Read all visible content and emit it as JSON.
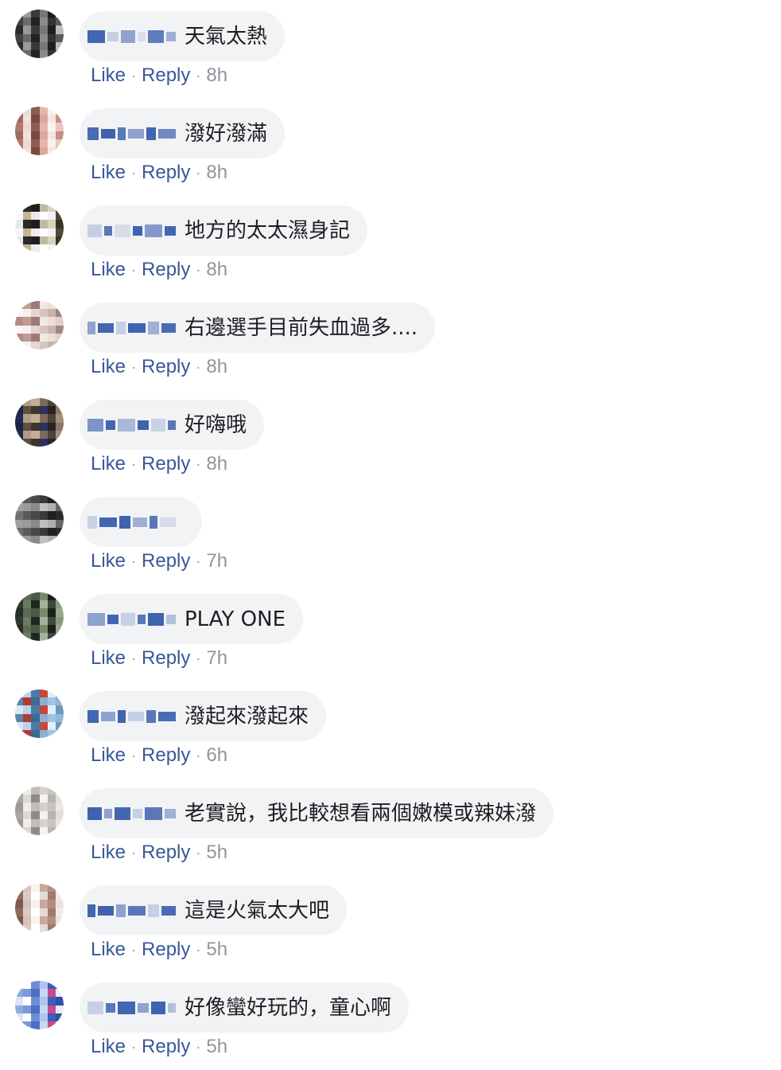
{
  "comments": [
    {
      "text": "天氣太熱",
      "like_label": "Like",
      "reply_label": "Reply",
      "time": "8h",
      "avatar_colors": [
        "#2b2b2b",
        "#6a6a6a",
        "#3a3a3a",
        "#8b8b8b",
        "#1e1e1e",
        "#5a5a5a",
        "#444444",
        "#999999",
        "#222222",
        "#777777",
        "#333333",
        "#bbbbbb"
      ],
      "name_blocks": [
        "#4267b2",
        "#c7cfe3",
        "#8fa3cc",
        "#d9deea",
        "#5f7dbb",
        "#9fb0d4"
      ]
    },
    {
      "text": "潑好潑滿",
      "like_label": "Like",
      "reply_label": "Reply",
      "time": "8h",
      "avatar_colors": [
        "#e9c6c0",
        "#b07a6d",
        "#f3e0da",
        "#8f5b52",
        "#d9a89c",
        "#fbf0ec",
        "#c68f83",
        "#a06a5e",
        "#eddad4",
        "#7a4a40",
        "#e2b7ad",
        "#f6e6e1"
      ],
      "name_blocks": [
        "#4a6cb4",
        "#3f63ae",
        "#5a79ba",
        "#8ea2cf",
        "#4267b2",
        "#6f89c2"
      ]
    },
    {
      "text": "地方的太太濕身記",
      "like_label": "Like",
      "reply_label": "Reply",
      "time": "8h",
      "avatar_colors": [
        "#f2f2f2",
        "#3a3326",
        "#e8e8e8",
        "#c4b58d",
        "#1e1e1e",
        "#ffffff",
        "#d8d1bd",
        "#4e4838",
        "#f7f7f7",
        "#2a2a2a",
        "#ececec",
        "#bfb9a6"
      ],
      "name_blocks": [
        "#c5cfe4",
        "#5a77b8",
        "#d6dcea",
        "#3f63ae",
        "#8499c9",
        "#4267b2"
      ]
    },
    {
      "text": "右邊選手目前失血過多....",
      "like_label": "Like",
      "reply_label": "Reply",
      "time": "8h",
      "avatar_colors": [
        "#f1e8e6",
        "#c9b3ae",
        "#e2cfcb",
        "#b58b84",
        "#f7f0ee",
        "#9c7b75",
        "#d8c4bf",
        "#ebddd9",
        "#a48680",
        "#fbf5f4",
        "#c09d97",
        "#e6d6d2"
      ],
      "name_blocks": [
        "#8ea2cf",
        "#4267b2",
        "#c6d0e5",
        "#3f63ae",
        "#9fb0d4",
        "#4a6cb4"
      ]
    },
    {
      "text": "好嗨哦",
      "like_label": "Like",
      "reply_label": "Reply",
      "time": "8h",
      "avatar_colors": [
        "#3e342c",
        "#7c6a5a",
        "#2a2420",
        "#a38f7a",
        "#1f2a52",
        "#5c4f43",
        "#c3ae96",
        "#283262",
        "#4d4236",
        "#8a7866",
        "#1c2448",
        "#b09c86"
      ],
      "name_blocks": [
        "#7d93c6",
        "#4267b2",
        "#a9b8da",
        "#3f63ae",
        "#c9d1e5",
        "#5a77b8"
      ]
    },
    {
      "text": "",
      "like_label": "Like",
      "reply_label": "Reply",
      "time": "7h",
      "avatar_colors": [
        "#5a5a5a",
        "#8a8a8a",
        "#3a3a3a",
        "#b0b0b0",
        "#2a2a2a",
        "#707070",
        "#9a9a9a",
        "#4a4a4a",
        "#c0c0c0",
        "#202020",
        "#666666",
        "#a0a0a0"
      ],
      "name_blocks": [
        "#c8d0e4",
        "#4267b2",
        "#3f63ae",
        "#9fb0d4",
        "#5a77b8",
        "#d5dbe9"
      ]
    },
    {
      "text": "PLAY ONE",
      "like_label": "Like",
      "reply_label": "Reply",
      "time": "7h",
      "avatar_colors": [
        "#2f3a2c",
        "#5d6b55",
        "#1f2620",
        "#7a8870",
        "#3e4a38",
        "#98a68e",
        "#26302a",
        "#6b7a62",
        "#4a5a42",
        "#a4b19c",
        "#1a201a",
        "#8a9880"
      ],
      "name_blocks": [
        "#8ea2cf",
        "#4267b2",
        "#c6d0e5",
        "#5a77b8",
        "#3f63ae",
        "#b3c0dd"
      ]
    },
    {
      "text": "潑起來潑起來",
      "like_label": "Like",
      "reply_label": "Reply",
      "time": "6h",
      "avatar_colors": [
        "#8fb8d8",
        "#5a86ad",
        "#b9d4ea",
        "#3e6a92",
        "#c7463f",
        "#a1c3e0",
        "#6f97bd",
        "#d9e8f4",
        "#b33a34",
        "#4d7aa2",
        "#8eb0cf",
        "#e3eef7"
      ],
      "name_blocks": [
        "#4267b2",
        "#8ea2cf",
        "#3f63ae",
        "#c6d0e5",
        "#5a77b8",
        "#4a6cb4"
      ]
    },
    {
      "text": "老實說，我比較想看兩個嫩模或辣妹潑",
      "like_label": "Like",
      "reply_label": "Reply",
      "time": "5h",
      "avatar_colors": [
        "#c7c4bf",
        "#e2dfda",
        "#a9a59f",
        "#f0ede9",
        "#8e8a84",
        "#d4d1cc",
        "#b8b4ae",
        "#eae7e3",
        "#9d9993",
        "#dcd9d4",
        "#c0bcb6",
        "#f5f3f0"
      ],
      "name_blocks": [
        "#3f63ae",
        "#8ea2cf",
        "#4267b2",
        "#c6d0e5",
        "#5a77b8",
        "#9fb0d4"
      ]
    },
    {
      "text": "這是火氣太大吧",
      "like_label": "Like",
      "reply_label": "Reply",
      "time": "5h",
      "avatar_colors": [
        "#e6dcd6",
        "#b58e80",
        "#f2ebe7",
        "#8f6a5e",
        "#d6c3ba",
        "#ffffff",
        "#c7a89c",
        "#a07a6d",
        "#ede2dd",
        "#7c5a50",
        "#dccbc3",
        "#f8f3f0"
      ],
      "name_blocks": [
        "#4267b2",
        "#3f63ae",
        "#8ea2cf",
        "#5a77b8",
        "#c6d0e5",
        "#4a6cb4"
      ]
    },
    {
      "text": "好像蠻好玩的，童心啊",
      "like_label": "Like",
      "reply_label": "Reply",
      "time": "5h",
      "avatar_colors": [
        "#6e8fd6",
        "#c9d7f3",
        "#3a5fb4",
        "#e7edf9",
        "#8ea9e0",
        "#ffffff",
        "#4d6fc0",
        "#b2c4ec",
        "#c94a8e",
        "#2f52a6",
        "#dbe4f7",
        "#7a98da"
      ],
      "name_blocks": [
        "#c6d0e5",
        "#5a77b8",
        "#4267b2",
        "#8ea2cf",
        "#3f63ae",
        "#b3c0dd"
      ]
    }
  ]
}
